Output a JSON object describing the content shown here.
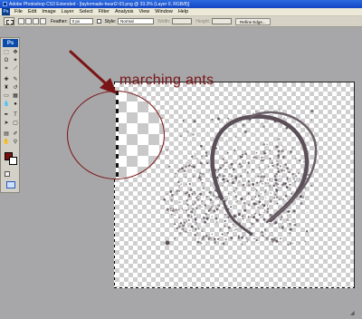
{
  "window": {
    "title": "Adobe Photoshop CS3 Extended - [taylormade-heart2-03.png @ 33.3% (Layer 0, RGB/8)]"
  },
  "menu": {
    "logo": "Ps",
    "items": [
      "File",
      "Edit",
      "Image",
      "Layer",
      "Select",
      "Filter",
      "Analysis",
      "View",
      "Window",
      "Help"
    ]
  },
  "options": {
    "feather_label": "Feather:",
    "feather_value": "0 px",
    "style_label": "Style:",
    "style_value": "Normal",
    "width_label": "Width:",
    "height_label": "Height:",
    "refine_edge_label": "Refine Edge..."
  },
  "toolbox": {
    "logo": "Ps",
    "tool_icons": [
      "marquee-icon",
      "move-icon",
      "lasso-icon",
      "magic-wand-icon",
      "crop-icon",
      "slice-icon",
      "healing-brush-icon",
      "brush-icon",
      "clone-stamp-icon",
      "history-brush-icon",
      "eraser-icon",
      "gradient-icon",
      "blur-icon",
      "dodge-icon",
      "pen-icon",
      "type-icon",
      "path-selection-icon",
      "shape-icon",
      "notes-icon",
      "eyedropper-icon",
      "hand-icon",
      "zoom-icon"
    ],
    "foreground_color": "#7a0f12",
    "background_color": "#ffffff"
  },
  "annotation": {
    "label": "marching ants",
    "color": "#7b1416"
  },
  "artwork": {
    "heart_color": "#5b4f58"
  }
}
